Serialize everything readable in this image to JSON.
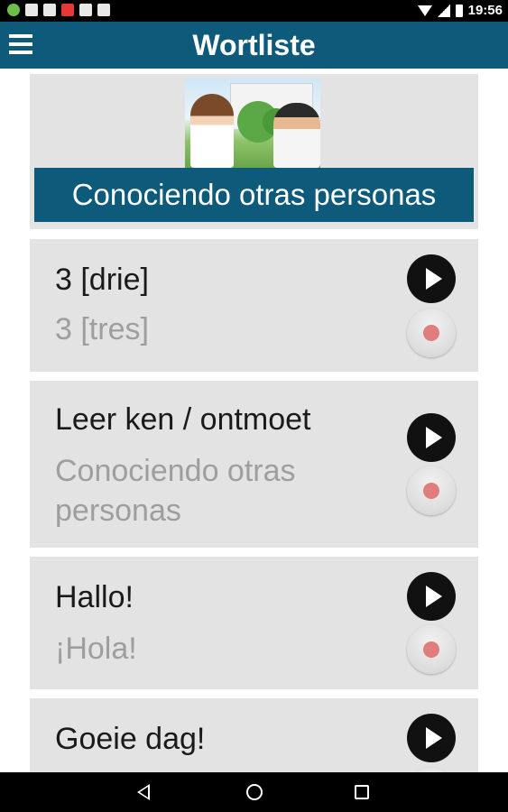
{
  "status_bar": {
    "time": "19:56"
  },
  "app_bar": {
    "title": "Wortliste"
  },
  "header": {
    "title": "Conociendo otras personas"
  },
  "items": [
    {
      "word": "3 [drie]",
      "translation": "3 [tres]"
    },
    {
      "word": "Leer ken / ontmoet",
      "translation": "Conociendo otras personas"
    },
    {
      "word": "Hallo!",
      "translation": "¡Hola!"
    },
    {
      "word": "Goeie dag!",
      "translation": ""
    }
  ],
  "colors": {
    "primary": "#0d5a7a",
    "card_bg": "#e3e3e3",
    "translation_text": "#9e9e9e",
    "record_dot": "#e27d7d"
  }
}
